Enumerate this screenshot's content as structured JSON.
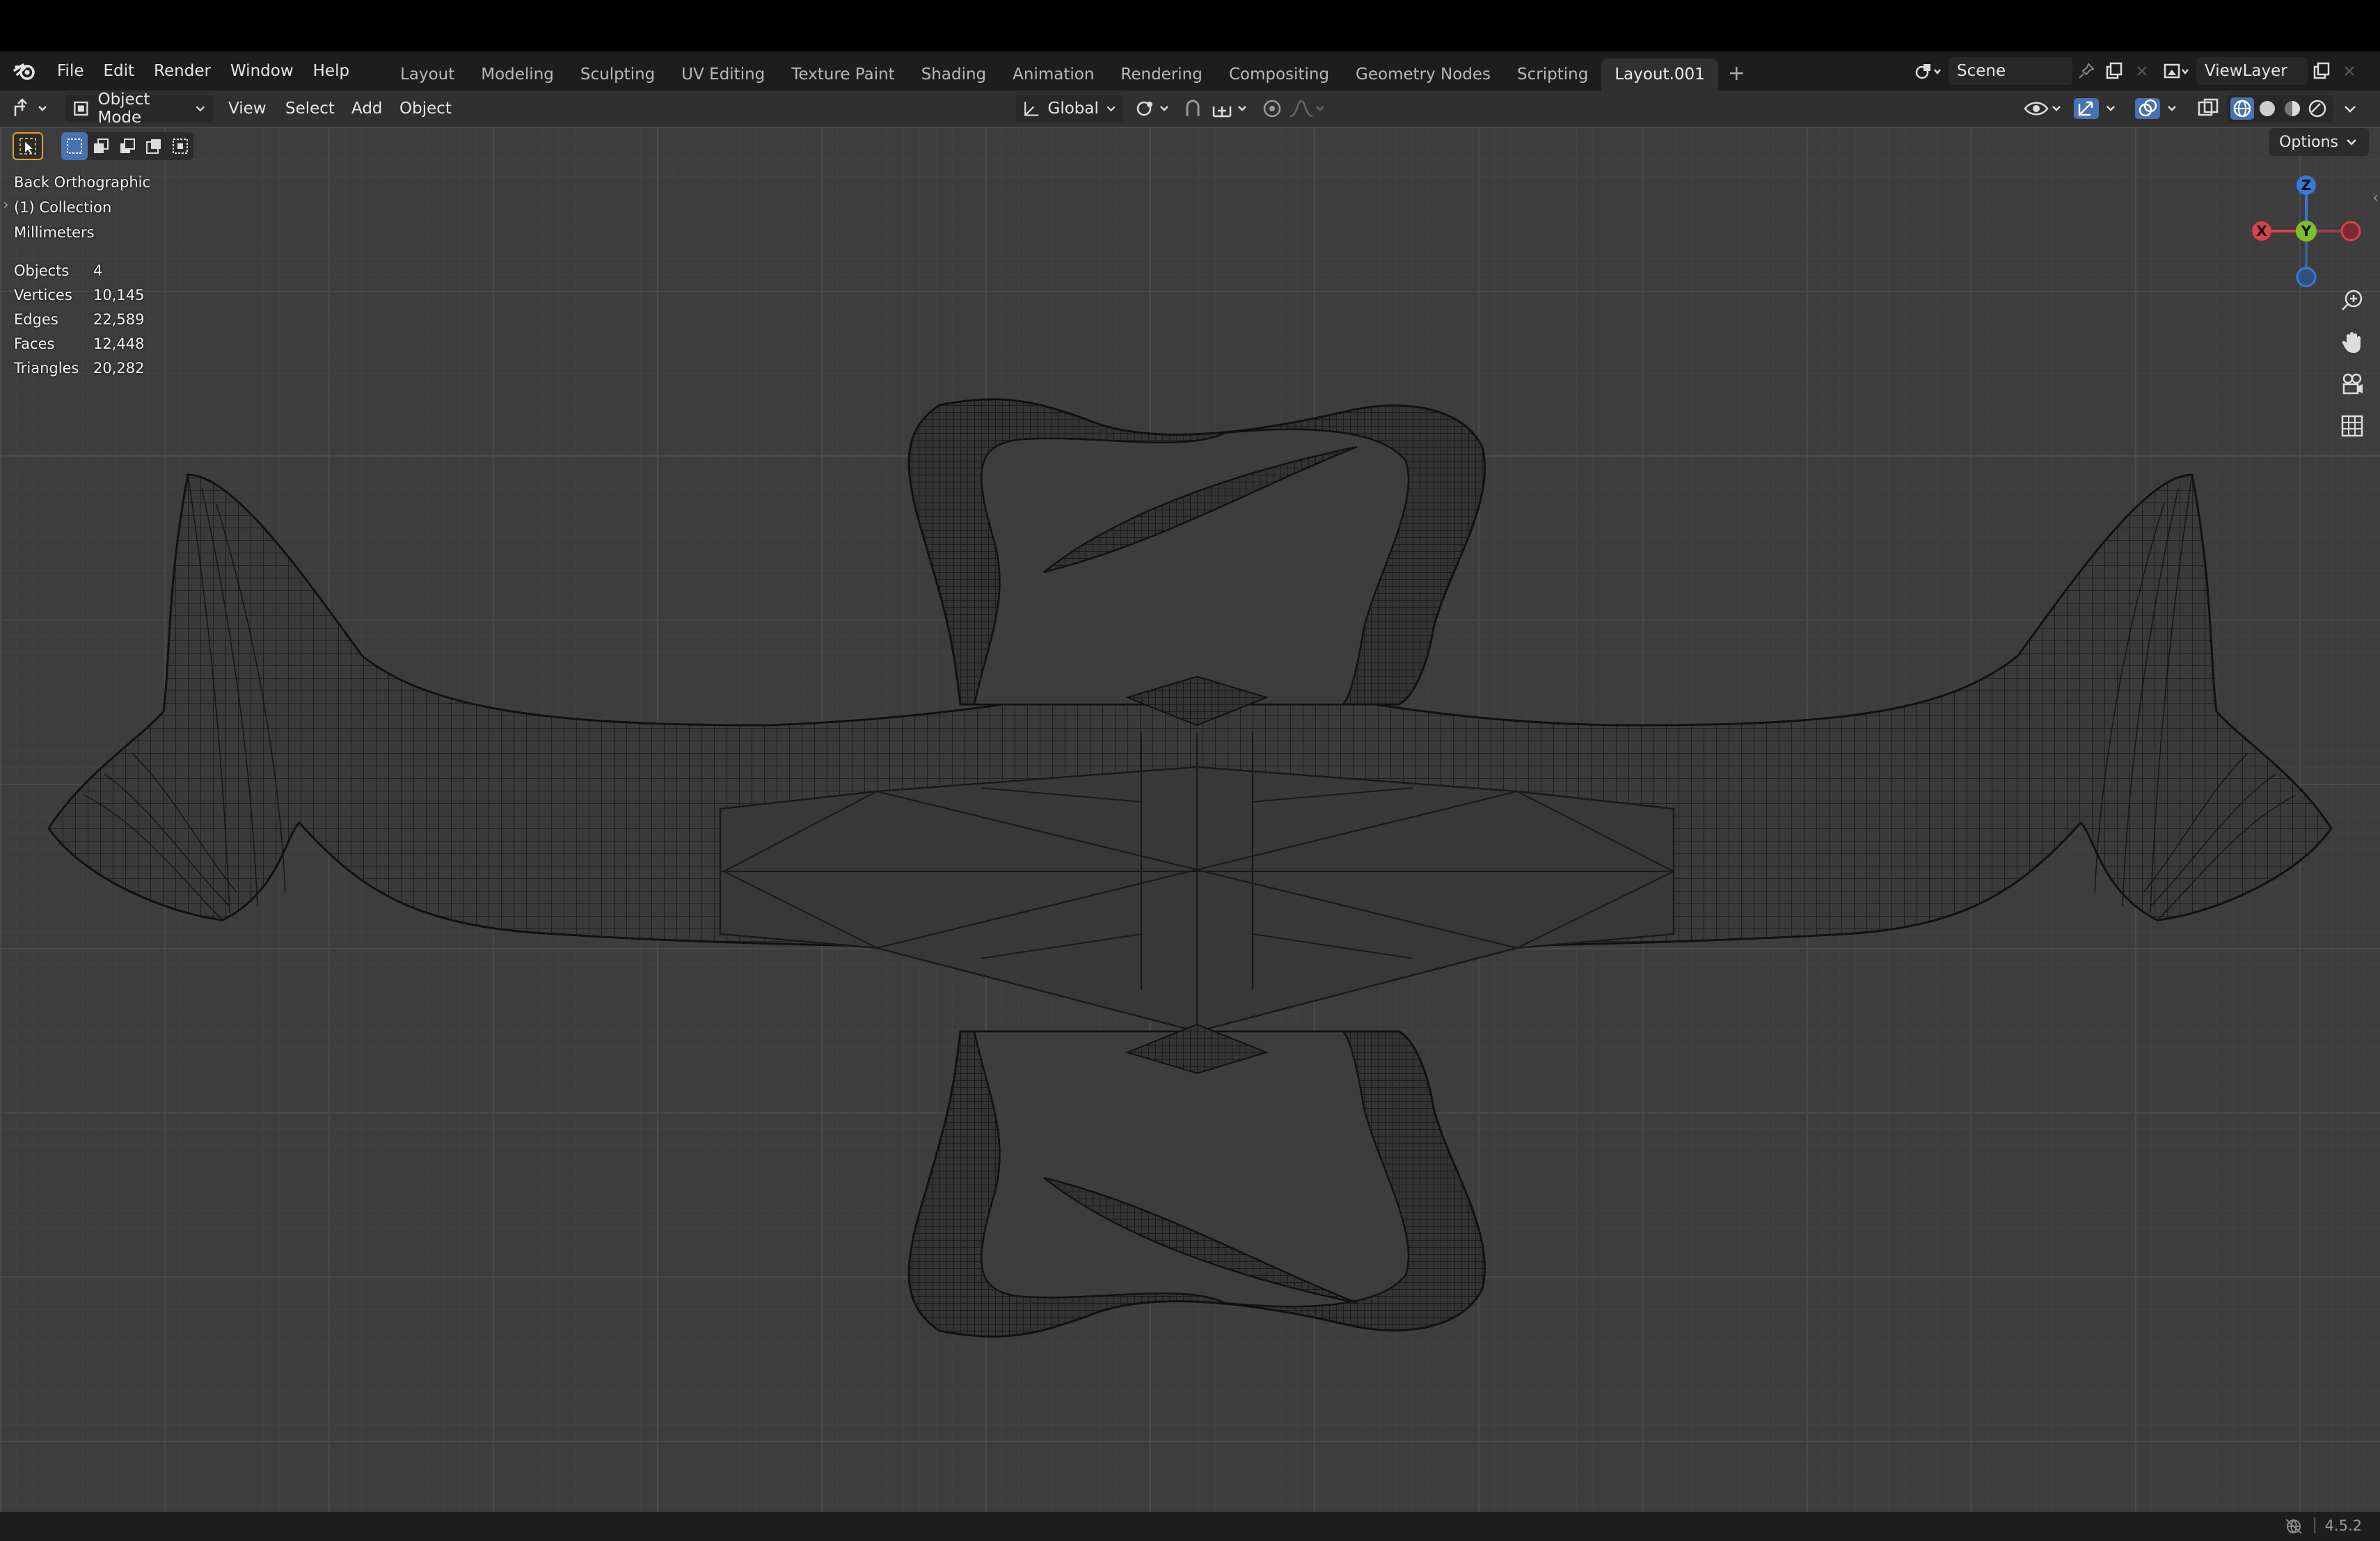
{
  "menu": {
    "items": [
      "File",
      "Edit",
      "Render",
      "Window",
      "Help"
    ]
  },
  "workspaces": {
    "tabs": [
      "Layout",
      "Modeling",
      "Sculpting",
      "UV Editing",
      "Texture Paint",
      "Shading",
      "Animation",
      "Rendering",
      "Compositing",
      "Geometry Nodes",
      "Scripting",
      "Layout.001"
    ],
    "active": "Layout.001",
    "add_label": "+"
  },
  "scene": {
    "name": "Scene"
  },
  "view_layer": {
    "name": "ViewLayer"
  },
  "header": {
    "mode": "Object Mode",
    "menus": [
      "View",
      "Select",
      "Add",
      "Object"
    ],
    "orientation": "Global"
  },
  "viewport": {
    "view_name": "Back Orthographic",
    "collection": "(1) Collection",
    "units": "Millimeters",
    "options_label": "Options",
    "stats": [
      {
        "label": "Objects",
        "value": "4"
      },
      {
        "label": "Vertices",
        "value": "10,145"
      },
      {
        "label": "Edges",
        "value": "22,589"
      },
      {
        "label": "Faces",
        "value": "12,448"
      },
      {
        "label": "Triangles",
        "value": "20,282"
      }
    ],
    "gizmo": {
      "z": "Z",
      "y": "Y",
      "x": "X"
    }
  },
  "status": {
    "version": "4.5.2"
  },
  "colors": {
    "accent": "#4772b3",
    "axis_x": "#d8424e",
    "axis_y": "#7cbf2a",
    "axis_z": "#3a78d8"
  }
}
